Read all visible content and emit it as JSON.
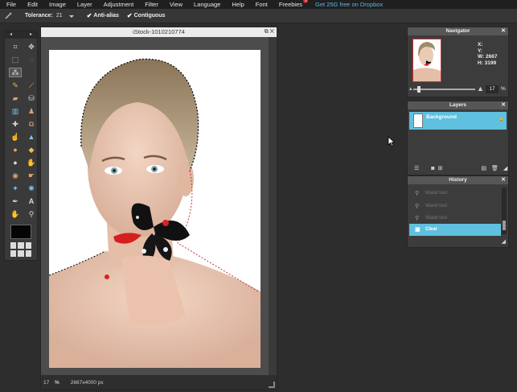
{
  "menubar": {
    "items": [
      "File",
      "Edit",
      "Image",
      "Layer",
      "Adjustment",
      "Filter",
      "View",
      "Language",
      "Help",
      "Font",
      "Freebies"
    ],
    "freebies_badge": "5",
    "promo": "Get 25G free on Dropbox"
  },
  "options": {
    "tolerance_label": "Tolerance:",
    "tolerance_value": "21",
    "anti_alias_label": "Anti-alias",
    "contiguous_label": "Contiguous"
  },
  "toolbox": {
    "tools": [
      "crop-icon",
      "move-icon",
      "marquee-icon",
      "lasso-icon",
      "magic-wand-icon",
      "blank",
      "pencil-icon",
      "brush-icon",
      "eraser-icon",
      "fill-icon",
      "gradient-icon",
      "stamp-icon",
      "heal-icon",
      "clone-icon",
      "smudge-icon",
      "blur-icon",
      "dodge-icon",
      "burn-icon",
      "sharpen-icon",
      "sponge-icon",
      "redeye-icon",
      "liquify-icon",
      "spot-icon",
      "color-picker-icon",
      "pen-icon",
      "type-icon",
      "hand-icon",
      "zoom-icon"
    ]
  },
  "document": {
    "title": "iStock-1010210774",
    "zoom": "17",
    "zoom_unit": "%",
    "dimensions": "2667x4000 px"
  },
  "navigator": {
    "title": "Navigator",
    "x_label": "X:",
    "y_label": "Y:",
    "w_label": "W:",
    "w_value": "2667",
    "h_label": "H:",
    "h_value": "3199",
    "zoom_value": "17",
    "zoom_unit": "%",
    "zoom_fraction": 0.08
  },
  "layers": {
    "title": "Layers",
    "items": [
      {
        "name": "Background",
        "locked": true
      }
    ]
  },
  "history": {
    "title": "History",
    "items": [
      {
        "label": "Wand tool",
        "active": false
      },
      {
        "label": "Wand tool",
        "active": false
      },
      {
        "label": "Wand tool",
        "active": false
      },
      {
        "label": "Clear",
        "active": true
      }
    ]
  },
  "colors": {
    "accent": "#5fc0df",
    "promo": "#5fb6e0",
    "badge": "#c8262b",
    "foreground_swatch": "#050505"
  }
}
